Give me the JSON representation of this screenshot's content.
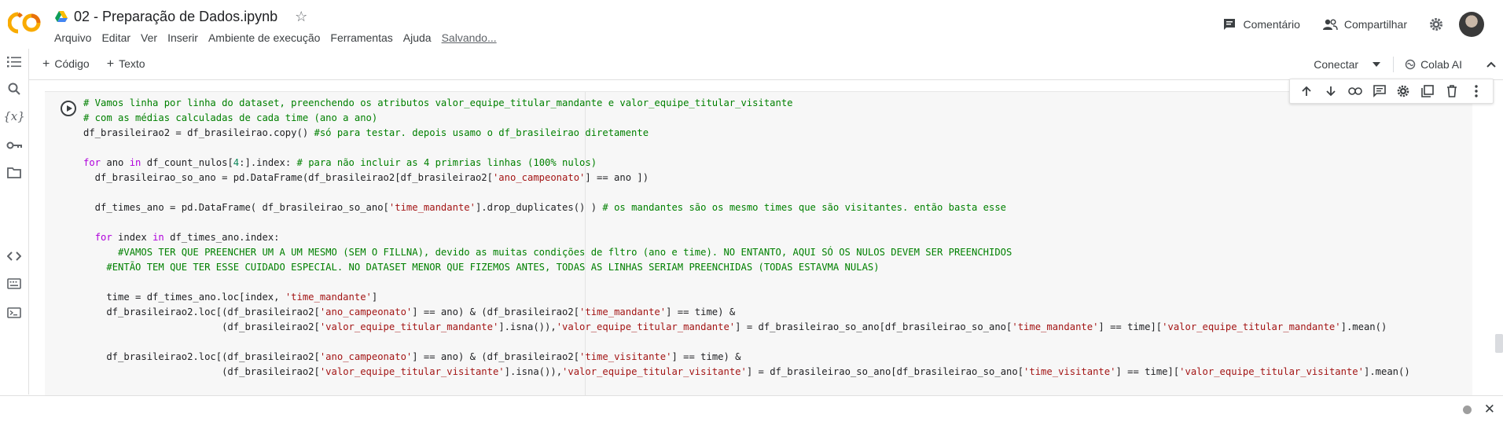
{
  "header": {
    "doc_title": "02 - Preparação de Dados.ipynb",
    "star_icon": "star-icon",
    "menu": [
      "Arquivo",
      "Editar",
      "Ver",
      "Inserir",
      "Ambiente de execução",
      "Ferramentas",
      "Ajuda"
    ],
    "saving_label": "Salvando...",
    "comment_label": "Comentário",
    "share_label": "Compartilhar"
  },
  "toolbar": {
    "add_code": "Código",
    "add_text": "Texto",
    "connect_label": "Conectar",
    "colab_ai_label": "Colab AI"
  },
  "cell": {
    "lines": [
      "# Vamos linha por linha do dataset, preenchendo os atributos valor_equipe_titular_mandante e valor_equipe_titular_visitante",
      "# com as médias calculadas de cada time (ano a ano)",
      "df_brasileirao2 = df_brasileirao.copy() #só para testar. depois usamo o df_brasileirao diretamente",
      "",
      "for ano in df_count_nulos[4:].index: # para não incluir as 4 primrias linhas (100% nulos)",
      "  df_brasileirao_so_ano = pd.DataFrame(df_brasileirao2[df_brasileirao2['ano_campeonato'] == ano ])",
      "",
      "  df_times_ano = pd.DataFrame( df_brasileirao_so_ano['time_mandante'].drop_duplicates() ) # os mandantes são os mesmo times que são visitantes. então basta esse",
      "",
      "  for index in df_times_ano.index:",
      "      #VAMOS TER QUE PREENCHER UM A UM MESMO (SEM O FILLNA), devido as muitas condições de fltro (ano e time). NO ENTANTO, AQUI SÓ OS NULOS DEVEM SER PREENCHIDOS",
      "    #ENTÃO TEM QUE TER ESSE CUIDADO ESPECIAL. NO DATASET MENOR QUE FIZEMOS ANTES, TODAS AS LINHAS SERIAM PREENCHIDAS (TODAS ESTAVMA NULAS)",
      "",
      "    time = df_times_ano.loc[index, 'time_mandante']",
      "    df_brasileirao2.loc[(df_brasileirao2['ano_campeonato'] == ano) & (df_brasileirao2['time_mandante'] == time) &",
      "                        (df_brasileirao2['valor_equipe_titular_mandante'].isna()),'valor_equipe_titular_mandante'] = df_brasileirao_so_ano[df_brasileirao_so_ano['time_mandante'] == time]['valor_equipe_titular_mandante'].mean()",
      "",
      "    df_brasileirao2.loc[(df_brasileirao2['ano_campeonato'] == ano) & (df_brasileirao2['time_visitante'] == time) &",
      "                        (df_brasileirao2['valor_equipe_titular_visitante'].isna()),'valor_equipe_titular_visitante'] = df_brasileirao_so_ano[df_brasileirao_so_ano['time_visitante'] == time]['valor_equipe_titular_visitante'].mean()"
    ]
  },
  "colors": {
    "comment": "#008000",
    "keyword": "#af00db",
    "string": "#a31515",
    "number": "#098658",
    "logo_orange": "#f9ab00",
    "logo_dark": "#e8710a"
  }
}
